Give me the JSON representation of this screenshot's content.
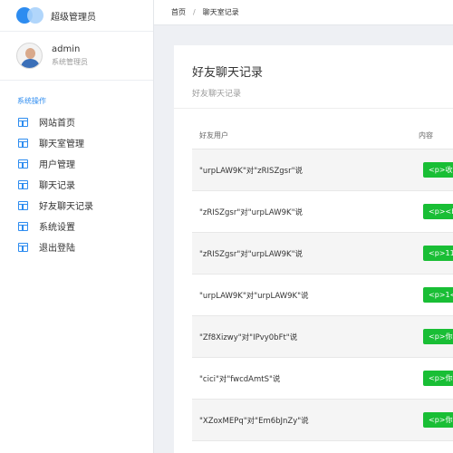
{
  "brand": {
    "title": "超级管理员"
  },
  "user": {
    "name": "admin",
    "role": "系统管理员"
  },
  "menu": {
    "title": "系统操作",
    "items": [
      {
        "label": "网站首页",
        "icon": "table-icon"
      },
      {
        "label": "聊天室管理",
        "icon": "table-icon"
      },
      {
        "label": "用户管理",
        "icon": "table-icon"
      },
      {
        "label": "聊天记录",
        "icon": "table-icon"
      },
      {
        "label": "好友聊天记录",
        "icon": "table-icon"
      },
      {
        "label": "系统设置",
        "icon": "table-icon"
      },
      {
        "label": "退出登陆",
        "icon": "table-icon"
      }
    ]
  },
  "breadcrumb": {
    "home": "首页",
    "separator": "/",
    "current": "聊天室记录"
  },
  "card": {
    "title": "好友聊天记录",
    "subtitle": "好友聊天记录"
  },
  "table": {
    "headers": {
      "user": "好友用户",
      "content": "内容"
    },
    "rows": [
      {
        "user": "\"urpLAW9K\"对\"zRISZgsr\"说",
        "content": "<p>收"
      },
      {
        "user": "\"zRISZgsr\"对\"urpLAW9K\"说",
        "content": "<p><b"
      },
      {
        "user": "\"zRISZgsr\"对\"urpLAW9K\"说",
        "content": "<p>11"
      },
      {
        "user": "\"urpLAW9K\"对\"urpLAW9K\"说",
        "content": "<p>1<"
      },
      {
        "user": "\"Zf8Xizwy\"对\"IPvy0bFt\"说",
        "content": "<p>你"
      },
      {
        "user": "\"cici\"对\"fwcdAmtS\"说",
        "content": "<p>你"
      },
      {
        "user": "\"XZoxMEPq\"对\"Em6bJnZy\"说",
        "content": "<p>你"
      }
    ]
  },
  "colors": {
    "accent": "#2d8cf0",
    "badge": "#19be35"
  }
}
